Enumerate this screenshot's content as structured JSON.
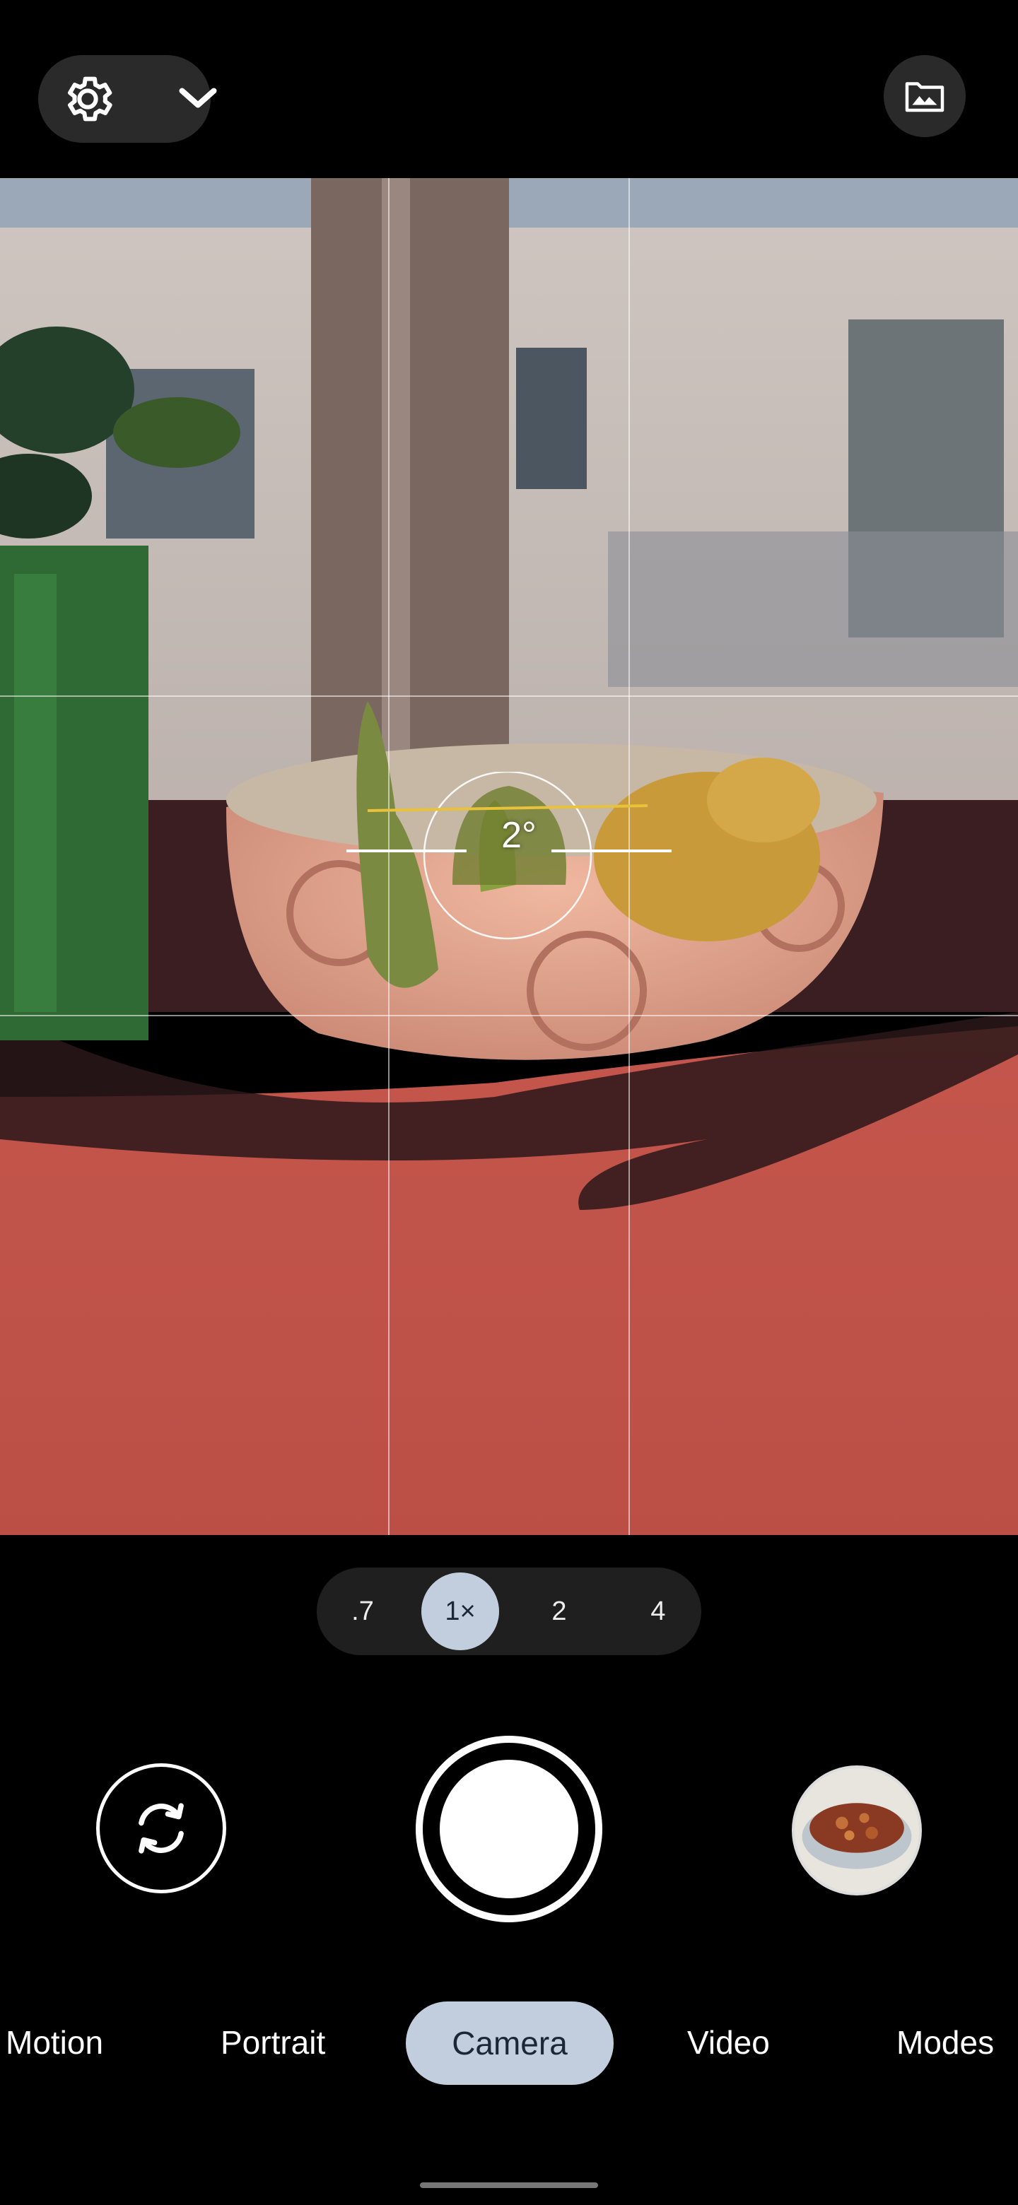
{
  "top_bar": {
    "settings_icon": "gear-icon",
    "dropdown_icon": "chevron-down-icon",
    "gallery_icon": "image-folder-icon"
  },
  "viewfinder": {
    "level_angle": "2°",
    "grid": "3x3"
  },
  "zoom": {
    "options": [
      ".7",
      "1×",
      "2",
      "4"
    ],
    "selected": "1×"
  },
  "controls": {
    "flip_icon": "switch-camera-icon",
    "shutter": "shutter-button",
    "last_photo": "gallery-thumbnail"
  },
  "modes": {
    "items": [
      "Motion",
      "Portrait",
      "Camera",
      "Video",
      "Modes"
    ],
    "active": "Camera"
  },
  "colors": {
    "active_pill": "#c2cede",
    "level_line": "#e8c23a",
    "background": "#000000"
  }
}
